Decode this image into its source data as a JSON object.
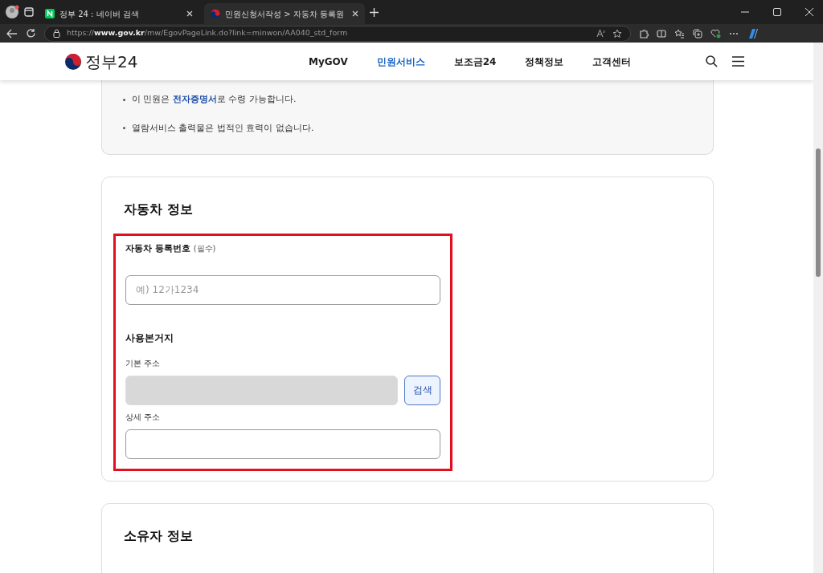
{
  "browser": {
    "tabs": [
      {
        "title": "정부 24 : 네이버 검색",
        "selected": false
      },
      {
        "title": "민원신청서작성 > 자동차 등록원",
        "selected": true
      }
    ],
    "url": "https://**www.gov.kr**/mw/EgovPageLink.do?link=minwon/AA040_std_form"
  },
  "site": {
    "logo": "정부24",
    "nav": [
      {
        "label": "MyGOV",
        "selected": false
      },
      {
        "label": "민원서비스",
        "selected": true
      },
      {
        "label": "보조금24",
        "selected": false
      },
      {
        "label": "정책정보",
        "selected": false
      },
      {
        "label": "고객센터",
        "selected": false
      }
    ]
  },
  "notices": [
    "이 민원은 **전자증명서**로 수령 가능합니다.",
    "열람서비스 출력물은 법적인 효력이 없습니다."
  ],
  "vehicle_section": {
    "title": "자동차 정보",
    "highlighted": true,
    "reg_number": {
      "label": "자동차 등록번호",
      "required": "(필수)",
      "placeholder": "예) 12가1234"
    },
    "address": {
      "title": "사용본거지",
      "basic_label": "기본 주소",
      "basic_disabled": true,
      "search_button": "검색",
      "detail_label": "상세 주소"
    }
  },
  "owner_section": {
    "title": "소유자 정보"
  }
}
